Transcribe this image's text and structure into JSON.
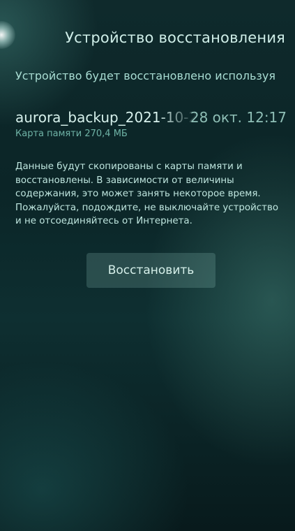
{
  "header": {
    "title": "Устройство восстановления"
  },
  "restore": {
    "intro": "Устройство будет восстановлено используя",
    "backup_name": "aurora_backup_2021-10-28",
    "backup_date": "28 окт. 12:17",
    "backup_meta": "Карта памяти 270,4 МБ",
    "description": "Данные будут скопированы с карты памяти и восстановлены. В зависимости от величины содержания, это может занять некоторое время. Пожалуйста, подождите, не выключайте устройство и не отсоединяйтесь от Интернета.",
    "button_label": "Восстановить"
  },
  "colors": {
    "background": "#0b2527",
    "accent_text": "#a9ddd3",
    "button_bg": "#3d5e5d"
  }
}
